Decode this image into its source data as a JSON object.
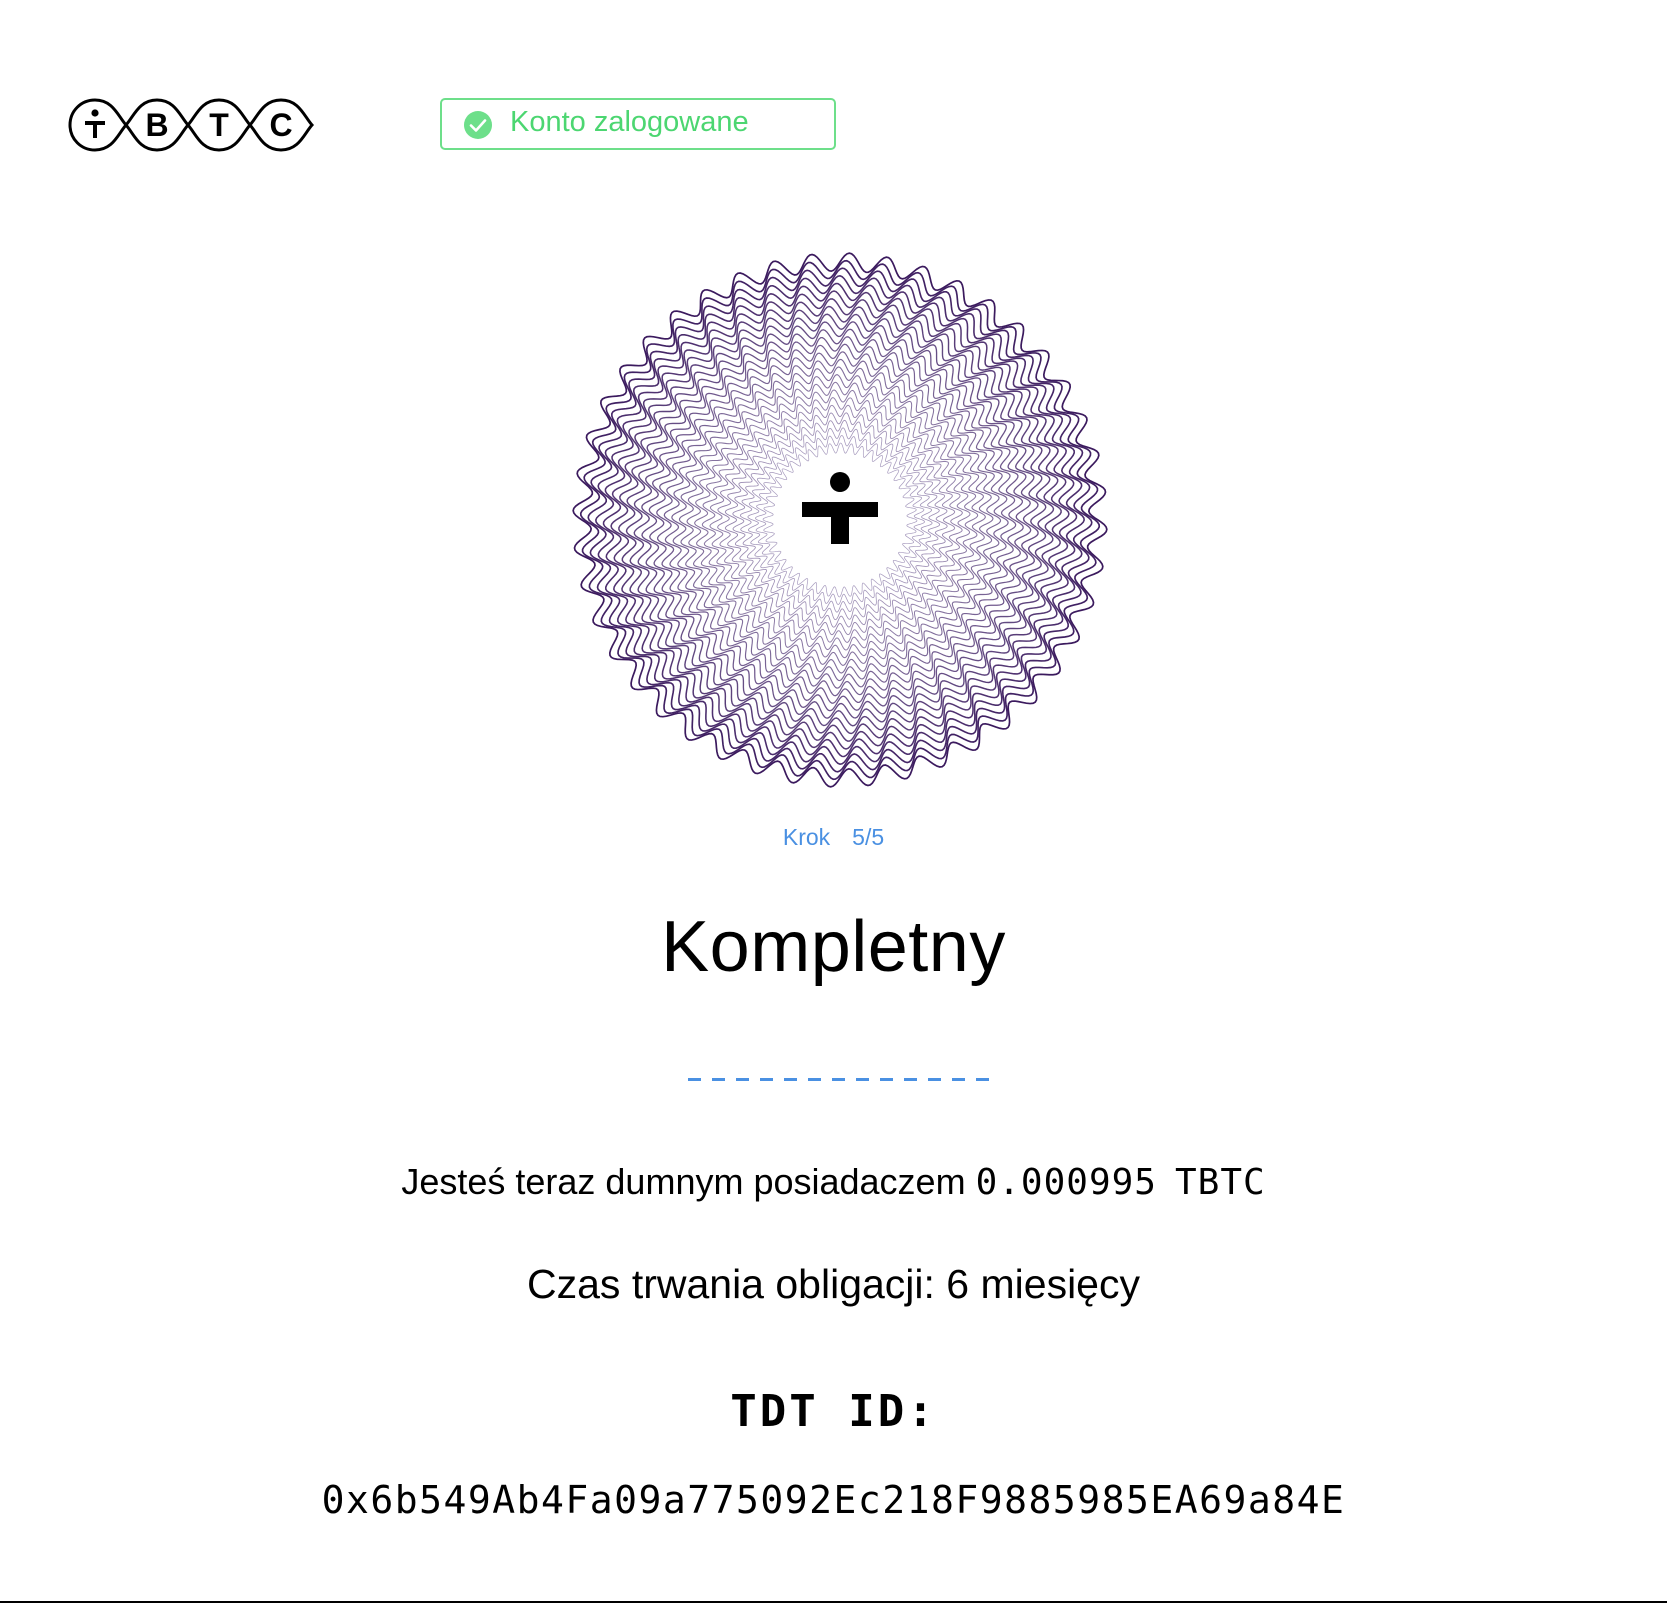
{
  "header": {
    "logo_text": "TBTC",
    "status_text": "Konto zalogowane"
  },
  "step": {
    "label": "Krok",
    "value": "5/5"
  },
  "main": {
    "title": "Kompletny",
    "ownership_sentence": "Jesteś teraz dumnym posiadaczem",
    "amount": "0.000995",
    "unit": "TBTC",
    "duration": "Czas trwania obligacji: 6 miesięcy",
    "tdt_label": "TDT ID:",
    "tdt_value": "0x6b549Ab4Fa09a775092Ec218F9885985EA69a84E"
  },
  "colors": {
    "accent_blue": "#4a90e2",
    "success_green": "#4cd671",
    "mandala_outer": "#3b1a5e",
    "mandala_inner": "#8a7aa8"
  },
  "icons": {
    "status": "check-circle-icon",
    "center": "tbtc-t-icon"
  }
}
